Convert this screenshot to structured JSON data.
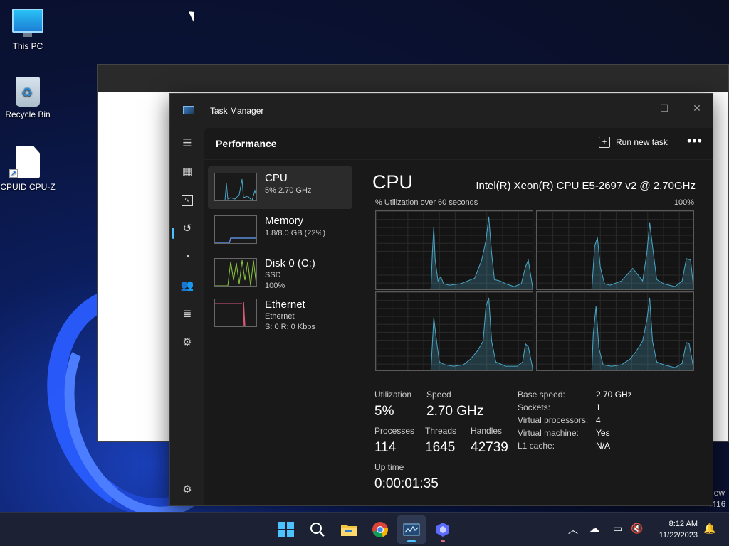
{
  "desktop": {
    "icons": [
      {
        "label": "This PC"
      },
      {
        "label": "Recycle Bin"
      },
      {
        "label": "CPUID CPU-Z"
      }
    ],
    "peek_text_1": "iew",
    "peek_text_2": ".416"
  },
  "window": {
    "title": "Task Manager",
    "page_heading": "Performance",
    "run_task_label": "Run new task",
    "more_label": "•••"
  },
  "resources": [
    {
      "name": "CPU",
      "sub1": "5% 2.70 GHz",
      "sub2": ""
    },
    {
      "name": "Memory",
      "sub1": "1.8/8.0 GB (22%)",
      "sub2": ""
    },
    {
      "name": "Disk 0 (C:)",
      "sub1": "SSD",
      "sub2": "100%"
    },
    {
      "name": "Ethernet",
      "sub1": "Ethernet",
      "sub2": "S: 0 R: 0 Kbps"
    }
  ],
  "cpu": {
    "title": "CPU",
    "model": "Intel(R) Xeon(R) CPU E5-2697 v2 @ 2.70GHz",
    "graph_label": "% Utilization over 60 seconds",
    "graph_max": "100%",
    "stats": {
      "utilization_label": "Utilization",
      "utilization": "5%",
      "speed_label": "Speed",
      "speed": "2.70 GHz",
      "processes_label": "Processes",
      "processes": "114",
      "threads_label": "Threads",
      "threads": "1645",
      "handles_label": "Handles",
      "handles": "42739",
      "uptime_label": "Up time",
      "uptime": "0:00:01:35"
    },
    "specs": [
      {
        "label": "Base speed:",
        "value": "2.70 GHz"
      },
      {
        "label": "Sockets:",
        "value": "1"
      },
      {
        "label": "Virtual processors:",
        "value": "4"
      },
      {
        "label": "Virtual machine:",
        "value": "Yes"
      },
      {
        "label": "L1 cache:",
        "value": "N/A"
      }
    ]
  },
  "taskbar": {
    "time": "8:12 AM",
    "date": "11/22/2023"
  },
  "colors": {
    "accent": "#4cc2ff",
    "cpu_line": "#4aa8c8",
    "memory_line": "#5a8ad6",
    "disk_line": "#8dc63f",
    "ethernet_line": "#d9577a"
  }
}
